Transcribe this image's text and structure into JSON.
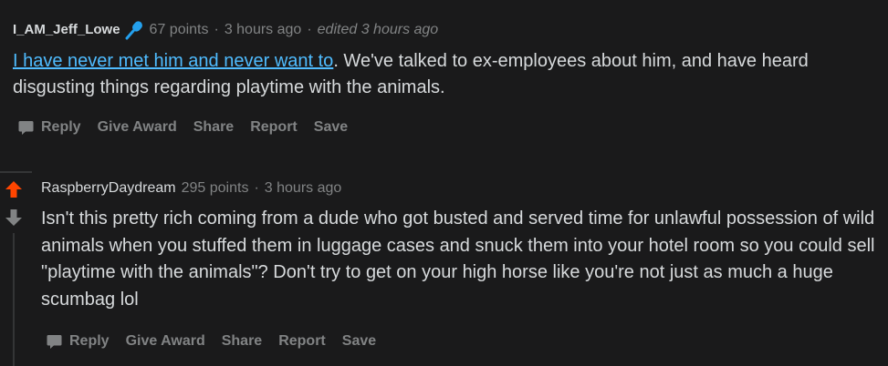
{
  "comment1": {
    "author": "I_AM_Jeff_Lowe",
    "points": "67 points",
    "time": "3 hours ago",
    "edited": "edited 3 hours ago",
    "link_text": "I have never met him and never want to",
    "body_rest": ". We've talked to ex-employees about him, and have heard disgusting things regarding playtime with the animals.",
    "actions": {
      "reply": "Reply",
      "give_award": "Give Award",
      "share": "Share",
      "report": "Report",
      "save": "Save"
    }
  },
  "comment2": {
    "author": "RaspberryDaydream",
    "points": "295 points",
    "time": "3 hours ago",
    "body": "Isn't this pretty rich coming from a dude who got busted and served time for unlawful possession of wild animals when you stuffed them in luggage cases and snuck them into your hotel room so you could sell \"playtime with the animals\"? Don't try to get on your high horse like you're not just as much a huge scumbag lol",
    "actions": {
      "reply": "Reply",
      "give_award": "Give Award",
      "share": "Share",
      "report": "Report",
      "save": "Save"
    }
  },
  "icons": {
    "mic": "microphone-icon",
    "chat": "chat-bubble-icon",
    "upvote": "upvote-arrow-icon",
    "downvote": "downvote-arrow-icon"
  },
  "colors": {
    "background": "#1a1a1b",
    "text": "#d7dadc",
    "muted": "#818384",
    "link": "#4fbcff",
    "upvote": "#ff4500",
    "mic": "#24a0ed"
  }
}
